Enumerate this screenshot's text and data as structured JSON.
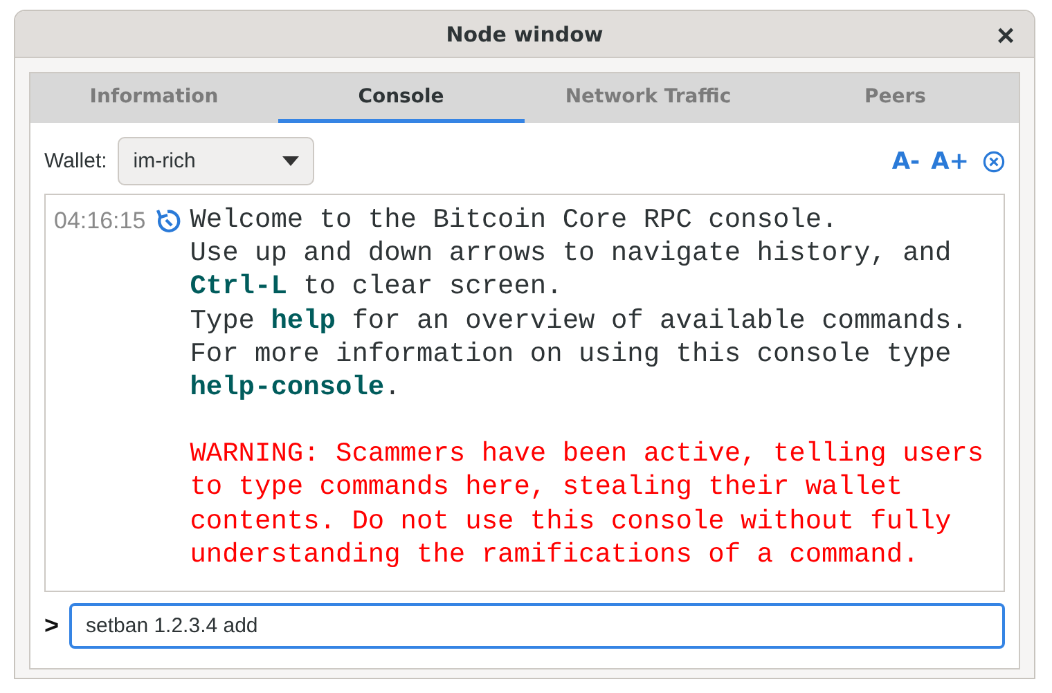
{
  "window": {
    "title": "Node window",
    "close": "×"
  },
  "tabs": [
    {
      "label": "Information",
      "selected": false
    },
    {
      "label": "Console",
      "selected": true
    },
    {
      "label": "Network Traffic",
      "selected": false
    },
    {
      "label": "Peers",
      "selected": false
    }
  ],
  "wallet": {
    "label": "Wallet:",
    "value": "im-rich"
  },
  "font_buttons": [
    "A-",
    "A+"
  ],
  "console": {
    "timestamp": "04:16:15",
    "paragraphs": [
      {
        "kind": "info",
        "text": "Welcome to the Bitcoin Core RPC console."
      },
      {
        "kind": "info",
        "text": "Use up and down arrows to navigate history, and **Ctrl-L** to clear screen."
      },
      {
        "kind": "info",
        "text": "Type **help** for an overview of available commands."
      },
      {
        "kind": "info",
        "text": "For more information on using this console type **help-console**."
      },
      {
        "kind": "warning",
        "text": "WARNING: Scammers have been active, telling users to type commands here, stealing their wallet contents. Do not use this console without fully understanding the ramifications of a command."
      }
    ]
  },
  "prompt": ">",
  "input": {
    "value": "setban 1.2.3.4 add"
  }
}
